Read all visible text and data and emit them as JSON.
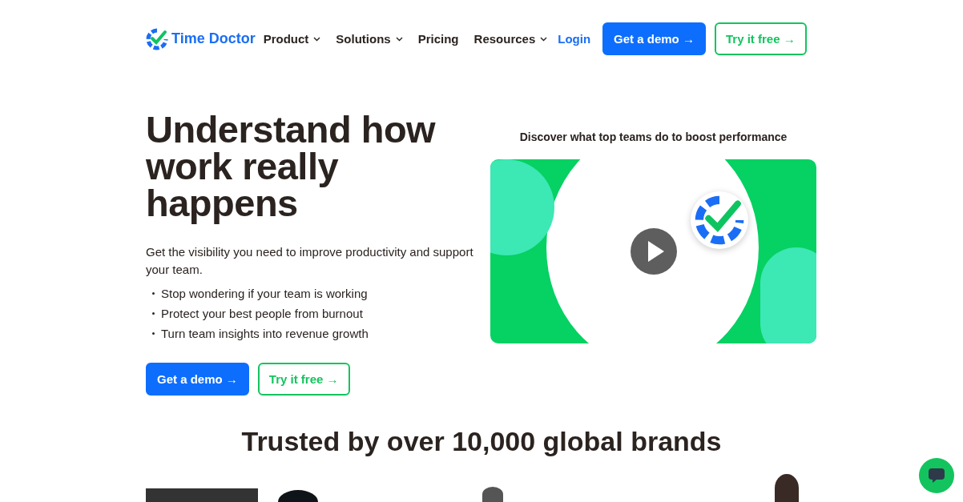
{
  "logo": {
    "text": "Time Doctor"
  },
  "nav": [
    {
      "label": "Product",
      "dropdown": true
    },
    {
      "label": "Solutions",
      "dropdown": true
    },
    {
      "label": "Pricing",
      "dropdown": false
    },
    {
      "label": "Resources",
      "dropdown": true
    }
  ],
  "login": "Login",
  "header_buttons": [
    {
      "label": "Get a demo →",
      "kind": "primary"
    },
    {
      "label": "Try it free →",
      "kind": "outline"
    }
  ],
  "hero": {
    "title": "Understand how work really happens",
    "subtitle": "Get the visibility you need to improve productivity and support your team.",
    "bullets": [
      "Stop wondering if your team is working",
      "Protect your best people from burnout",
      "Turn team insights into revenue growth"
    ],
    "buttons": [
      {
        "label": "Get a demo →",
        "kind": "primary"
      },
      {
        "label": "Try it free →",
        "kind": "outline"
      }
    ]
  },
  "video": {
    "caption": "Discover what top teams do to boost performance"
  },
  "brands": {
    "title": "Trusted by over 10,000 global brands"
  }
}
